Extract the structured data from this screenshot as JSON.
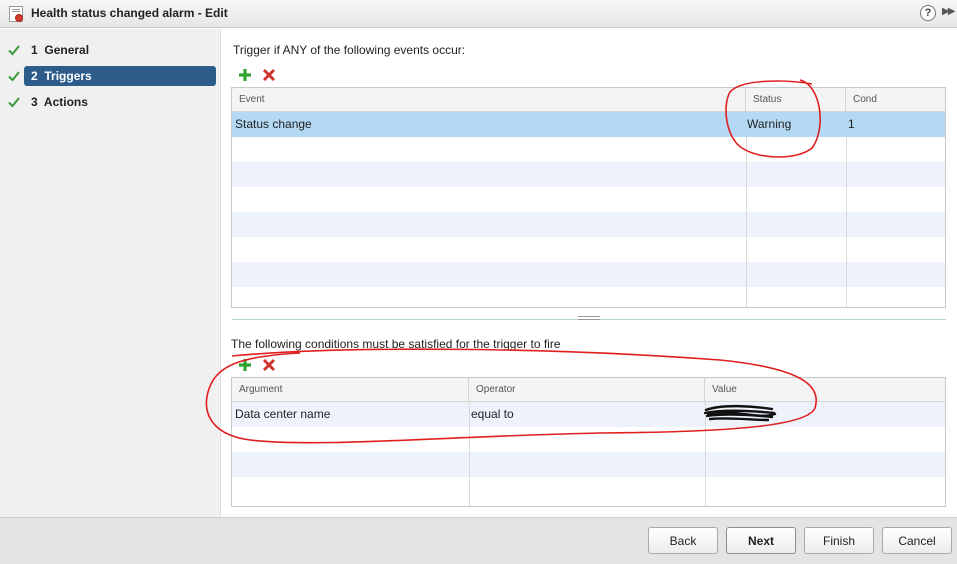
{
  "window": {
    "title": "Health status changed alarm - Edit",
    "help_label": "?",
    "expand_label": "▶▶"
  },
  "steps": [
    {
      "num": "1",
      "label": "General",
      "completed": true,
      "active": false
    },
    {
      "num": "2",
      "label": "Triggers",
      "completed": true,
      "active": true
    },
    {
      "num": "3",
      "label": "Actions",
      "completed": true,
      "active": false
    }
  ],
  "triggers": {
    "heading": "Trigger if ANY of the following events occur:",
    "columns": [
      "Event",
      "Status",
      "Cond"
    ],
    "rows": [
      {
        "event": "Status change",
        "status": "Warning",
        "cond": "1",
        "selected": true
      }
    ]
  },
  "conditions": {
    "heading": "The following conditions must be satisfied for the trigger to fire",
    "columns": [
      "Argument",
      "Operator",
      "Value"
    ],
    "rows": [
      {
        "argument": "Data center name",
        "operator": "equal to",
        "value": ""
      }
    ]
  },
  "footer": {
    "back": "Back",
    "next": "Next",
    "finish": "Finish",
    "cancel": "Cancel"
  },
  "colors": {
    "active_step": "#2e5c8a",
    "check_green": "#3a9a3a",
    "add_green": "#2fa52f",
    "remove_red": "#d0342c",
    "selected_row": "#b3d9f5",
    "annotation_red": "#e02020"
  },
  "icons": {
    "add": "plus-icon",
    "remove": "x-icon",
    "complete": "check-icon",
    "help": "help-icon"
  }
}
